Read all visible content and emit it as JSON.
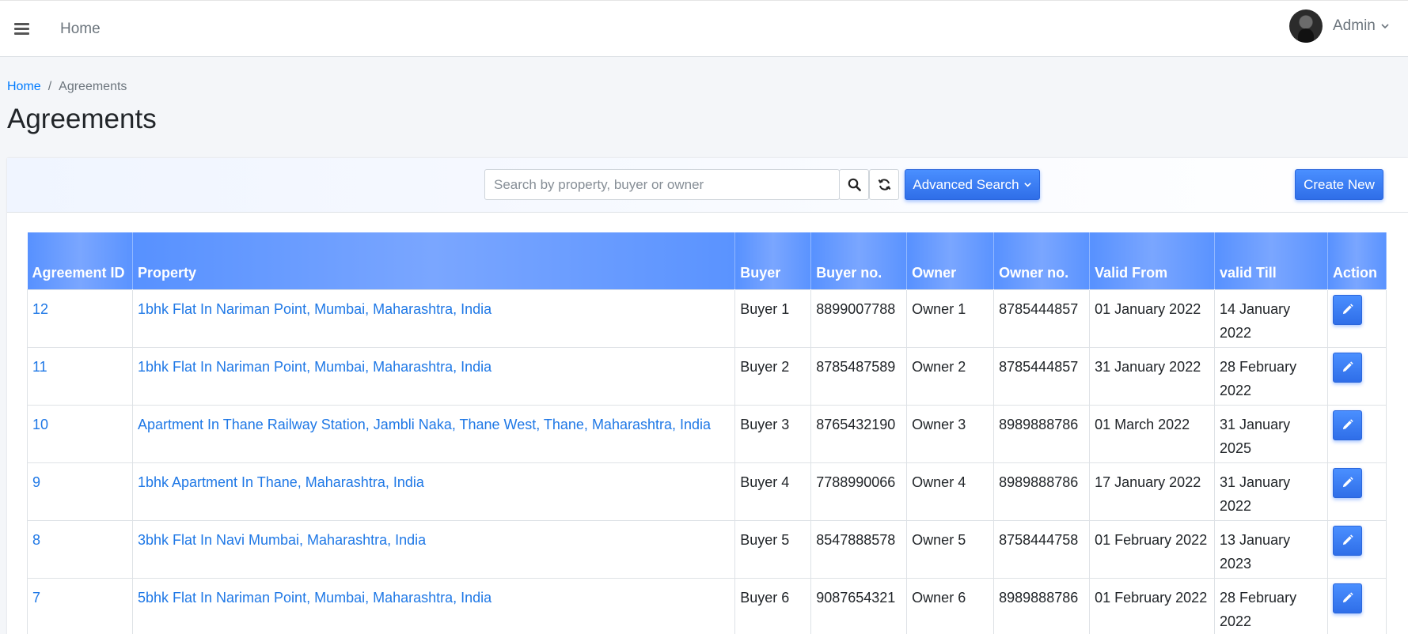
{
  "topbar": {
    "home_label": "Home",
    "user_name": "Admin"
  },
  "breadcrumb": {
    "home": "Home",
    "current": "Agreements"
  },
  "page_title": "Agreements",
  "toolbar": {
    "search_placeholder": "Search by property, buyer or owner",
    "advanced_search_label": "Advanced Search",
    "create_new_label": "Create New"
  },
  "table": {
    "headers": [
      "Agreement ID",
      "Property",
      "Buyer",
      "Buyer no.",
      "Owner",
      "Owner no.",
      "Valid From",
      "valid Till",
      "Action"
    ],
    "rows": [
      {
        "id": "12",
        "property": "1bhk Flat In Nariman Point, Mumbai, Maharashtra, India",
        "buyer": "Buyer 1",
        "buyer_no": "8899007788",
        "owner": "Owner 1",
        "owner_no": "8785444857",
        "valid_from": "01 January 2022",
        "valid_till": "14 January 2022"
      },
      {
        "id": "11",
        "property": "1bhk Flat In Nariman Point, Mumbai, Maharashtra, India",
        "buyer": "Buyer 2",
        "buyer_no": "8785487589",
        "owner": "Owner 2",
        "owner_no": "8785444857",
        "valid_from": "31 January 2022",
        "valid_till": "28 February 2022"
      },
      {
        "id": "10",
        "property": "Apartment In Thane Railway Station, Jambli Naka, Thane West, Thane, Maharashtra, India",
        "buyer": "Buyer 3",
        "buyer_no": "8765432190",
        "owner": "Owner 3",
        "owner_no": "8989888786",
        "valid_from": "01 March 2022",
        "valid_till": "31 January 2025"
      },
      {
        "id": "9",
        "property": "1bhk Apartment In Thane, Maharashtra, India",
        "buyer": "Buyer 4",
        "buyer_no": "7788990066",
        "owner": "Owner 4",
        "owner_no": "8989888786",
        "valid_from": "17 January 2022",
        "valid_till": "31 January 2022"
      },
      {
        "id": "8",
        "property": "3bhk Flat In Navi Mumbai, Maharashtra, India",
        "buyer": "Buyer 5",
        "buyer_no": "8547888578",
        "owner": "Owner 5",
        "owner_no": "8758444758",
        "valid_from": "01 February 2022",
        "valid_till": "13 January 2023"
      },
      {
        "id": "7",
        "property": "5bhk Flat In Nariman Point, Mumbai, Maharashtra, India",
        "buyer": "Buyer 6",
        "buyer_no": "9087654321",
        "owner": "Owner 6",
        "owner_no": "8989888786",
        "valid_from": "01 February 2022",
        "valid_till": "28 February 2022"
      }
    ]
  },
  "icons": {
    "menu": "hamburger-icon",
    "search": "search-icon",
    "refresh": "refresh-icon",
    "edit": "pencil-icon",
    "dropdown": "chevron-down-icon"
  },
  "colors": {
    "primary": "#2f6ee8",
    "link": "#1f78e6",
    "header_bg": "#5791ff"
  }
}
